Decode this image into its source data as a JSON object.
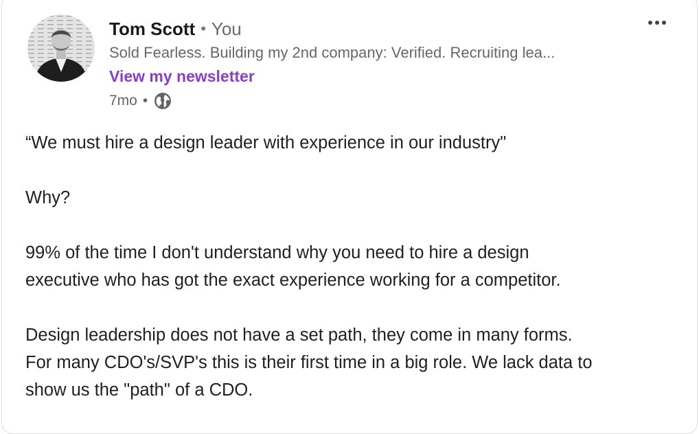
{
  "author": {
    "name": "Tom Scott",
    "separator": "•",
    "relation": "You",
    "headline": "Sold Fearless. Building my 2nd company: Verified. Recruiting lea...",
    "newsletter_link": "View my newsletter"
  },
  "meta": {
    "time_ago": "7mo",
    "separator": "•",
    "visibility_icon": "globe-icon"
  },
  "menu_icon": "more-horizontal-icon",
  "post": {
    "line1": "“We must hire a design leader with experience in our industry\"",
    "line2": "Why?",
    "line3": "99% of the time I don't understand why you need to hire a design",
    "line4": "executive who has got the exact experience working for a competitor.",
    "line5": "Design leadership does not have a set path, they come in many forms.",
    "line6": "For many CDO's/SVP's this is their first time in a big role. We lack data to",
    "line7": "show us the \"path\" of a CDO."
  },
  "colors": {
    "newsletter": "#8a3ccf",
    "border": "#dedede"
  }
}
